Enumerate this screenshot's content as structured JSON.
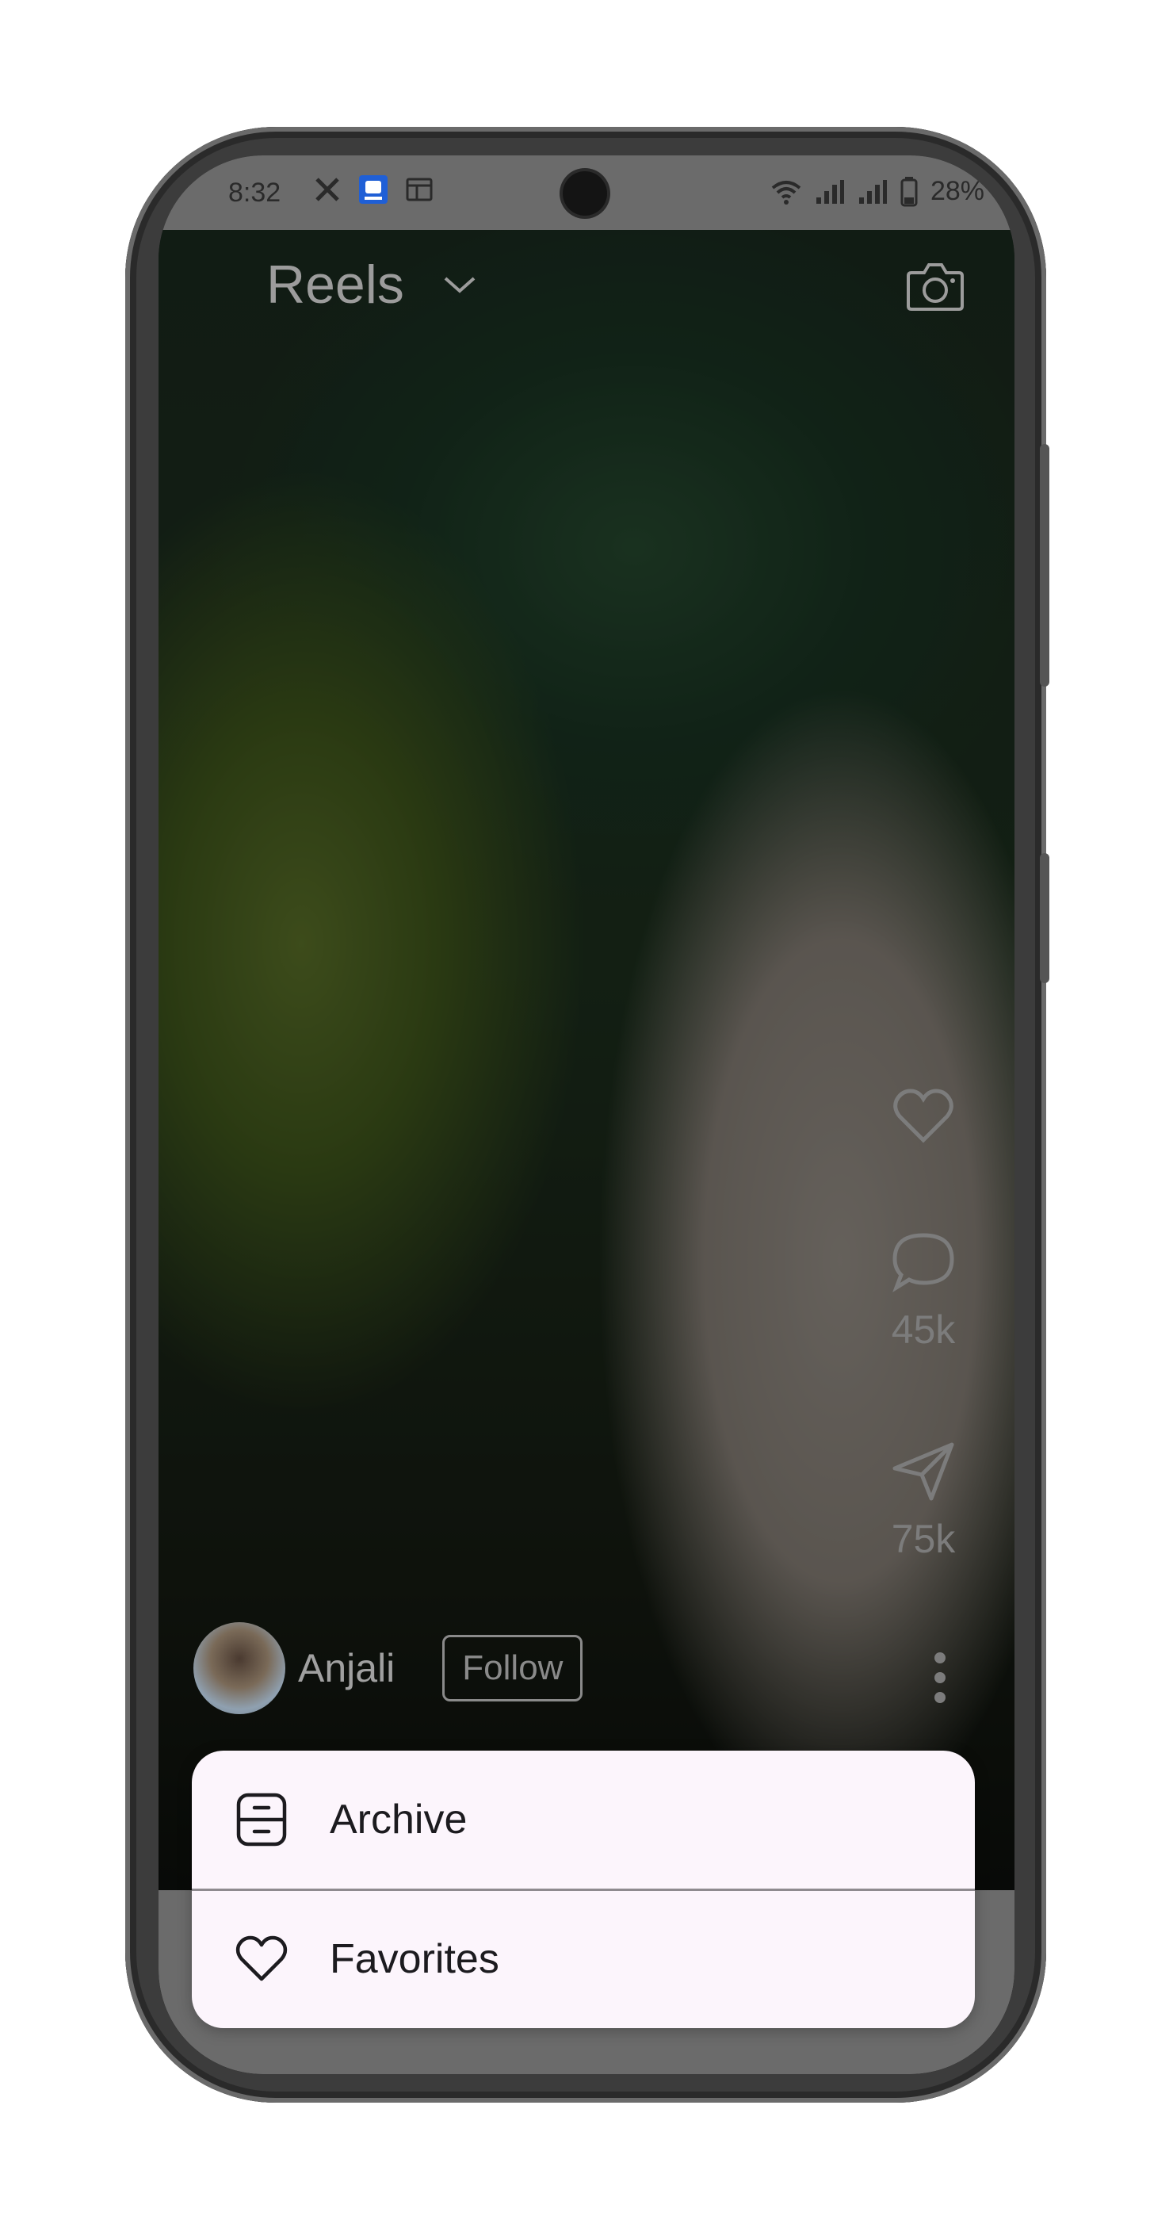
{
  "status_bar": {
    "time": "8:32",
    "battery": "28%",
    "icons": [
      "x-app-icon",
      "app-notification-icon",
      "window-icon",
      "wifi-icon",
      "signal-icon",
      "signal-icon-2",
      "battery-icon"
    ]
  },
  "header": {
    "title": "Reels",
    "dropdown_icon": "chevron-down-icon",
    "camera_icon": "camera-icon"
  },
  "actions": {
    "like_icon": "heart-icon",
    "comment_icon": "comment-icon",
    "comment_count": "45k",
    "share_icon": "send-icon",
    "share_count": "75k",
    "more_icon": "more-vertical-icon"
  },
  "user": {
    "name": "Anjali",
    "follow_label": "Follow"
  },
  "menu": {
    "items": [
      {
        "label": "Archive",
        "icon": "archive-icon"
      },
      {
        "label": "Favorites",
        "icon": "heart-outline-icon"
      }
    ]
  }
}
